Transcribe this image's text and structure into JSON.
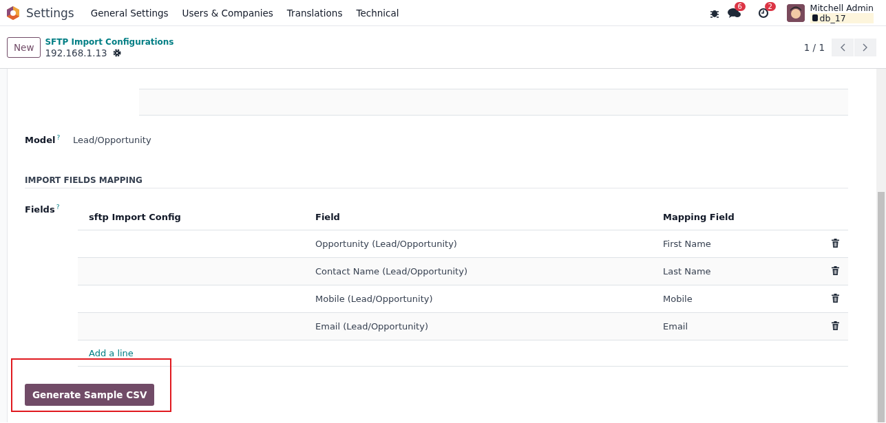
{
  "navbar": {
    "app_name": "Settings",
    "menu": [
      {
        "label": "General Settings"
      },
      {
        "label": "Users & Companies"
      },
      {
        "label": "Translations"
      },
      {
        "label": "Technical"
      }
    ],
    "messages_badge": "6",
    "activities_badge": "2",
    "user_name": "Mitchell Admin",
    "database": "db_17"
  },
  "control_panel": {
    "new_button": "New",
    "breadcrumb": "SFTP Import Configurations",
    "record_name": "192.168.1.13",
    "pager": "1 / 1"
  },
  "form": {
    "model_label": "Model",
    "model_help": "?",
    "model_value": "Lead/Opportunity",
    "section_title": "IMPORT FIELDS MAPPING",
    "fields_label": "Fields",
    "fields_help": "?",
    "table": {
      "columns": [
        "sftp Import Config",
        "Field",
        "Mapping Field"
      ],
      "rows": [
        {
          "column_1": "",
          "field": "Opportunity (Lead/Opportunity)",
          "mapping_field": "First Name"
        },
        {
          "column_1": "",
          "field": "Contact Name (Lead/Opportunity)",
          "mapping_field": "Last Name"
        },
        {
          "column_1": "",
          "field": "Mobile (Lead/Opportunity)",
          "mapping_field": "Mobile"
        },
        {
          "column_1": "",
          "field": "Email (Lead/Opportunity)",
          "mapping_field": "Email"
        }
      ],
      "add_line": "Add a line"
    },
    "generate_button": {
      "label": "Generate Sample CSV",
      "highlighted": true
    }
  }
}
